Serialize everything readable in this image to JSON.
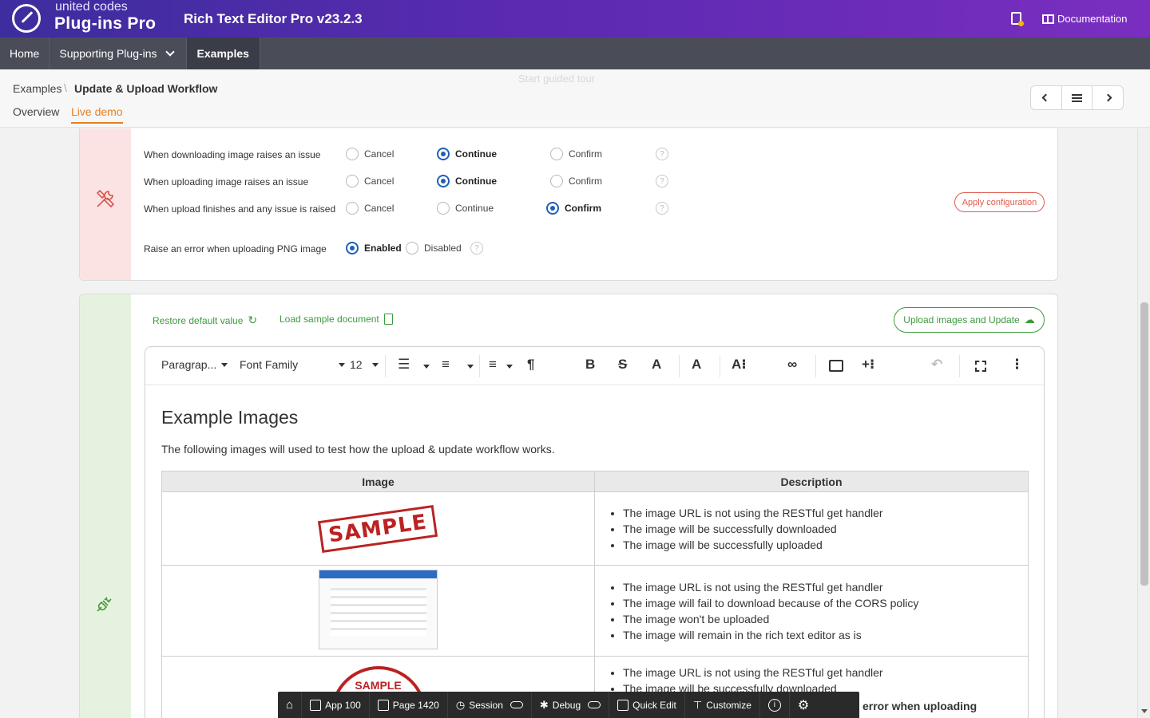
{
  "header": {
    "logo_sub": "united codes",
    "logo_main": "Plug-ins Pro",
    "app_title": "Rich Text Editor Pro v23.2.3",
    "documentation": "Documentation"
  },
  "nav": {
    "items": [
      {
        "label": "Home"
      },
      {
        "label": "Supporting Plug-ins"
      },
      {
        "label": "Examples"
      }
    ]
  },
  "breadcrumb": {
    "root": "Examples",
    "separator": "\\",
    "current": "Update & Upload Workflow"
  },
  "tabs": {
    "overview": "Overview",
    "live_demo": "Live demo"
  },
  "guided_tour": "Start guided tour",
  "config": {
    "rows": [
      {
        "label": "When downloading image raises an issue",
        "options": [
          "Cancel",
          "Continue",
          "Confirm"
        ],
        "selected": "Continue"
      },
      {
        "label": "When uploading image raises an issue",
        "options": [
          "Cancel",
          "Continue",
          "Confirm"
        ],
        "selected": "Continue"
      },
      {
        "label": "When upload finishes and any issue is raised",
        "options": [
          "Cancel",
          "Continue",
          "Confirm"
        ],
        "selected": "Confirm"
      }
    ],
    "png_label": "Raise an error when uploading PNG image",
    "png_options": [
      "Enabled",
      "Disabled"
    ],
    "png_selected": "Enabled",
    "apply_button": "Apply configuration",
    "help_glyph": "?"
  },
  "actions": {
    "restore": "Restore default value",
    "load_sample": "Load sample document",
    "upload": "Upload images and Update"
  },
  "editor": {
    "toolbar": {
      "paragraph": "Paragrap...",
      "font_family": "Font Family",
      "font_size": "12"
    },
    "heading": "Example Images",
    "intro": "The following images will used to test how the upload & update workflow works.",
    "table": {
      "headers": [
        "Image",
        "Description"
      ],
      "rows": [
        {
          "image": "SAMPLE",
          "bullets": [
            "The image URL is not using the RESTful get handler",
            "The image will be successfully downloaded",
            "The image will be successfully uploaded"
          ]
        },
        {
          "image": "screenshot",
          "bullets": [
            "The image URL is not using the RESTful get handler",
            "The image will fail to download because of the CORS policy",
            "The image won't be uploaded",
            "The image will remain in the rich text editor as is"
          ]
        },
        {
          "image": "SAMPLE",
          "bullets": [
            "The image URL is not using the RESTful get handler",
            "The image will be successfully downloaded"
          ]
        }
      ]
    }
  },
  "devbar": {
    "items": [
      "App 100",
      "Page 1420",
      "Session",
      "Debug",
      "Quick Edit",
      "Customize"
    ]
  },
  "overflow_text": "error when uploading"
}
